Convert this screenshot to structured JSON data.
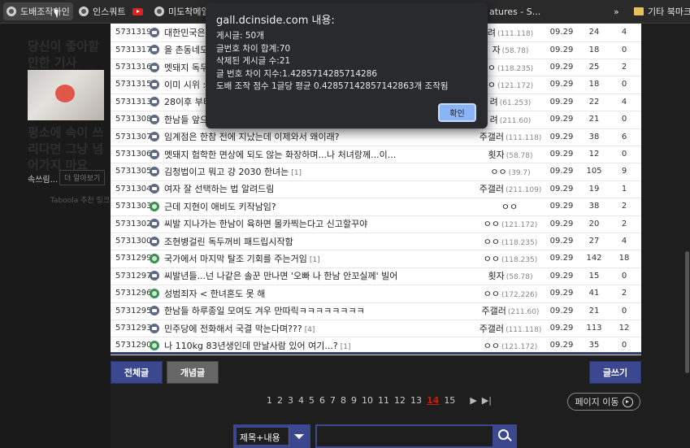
{
  "bookmarks": {
    "items": [
      {
        "label": "도배조작하인",
        "icon": "globe-icon"
      },
      {
        "label": "인스쿼트",
        "icon": "globe-icon"
      },
      {
        "label": "",
        "icon": "youtube-icon"
      },
      {
        "label": "미도착메일",
        "icon": "globe-icon"
      },
      {
        "label": "atures - S...",
        "icon": ""
      }
    ],
    "overflow": "»",
    "other_label": "기타 북마크"
  },
  "ad": {
    "title": "당신이 좋아할 만한 기사",
    "text": "평소에 속이 쓰리다면 그냥 넘어가지 마요",
    "source": "속쓰림...",
    "more": "더 알아보기",
    "provider": "Taboola 추천 링크"
  },
  "posts": [
    {
      "num": "5731319",
      "type": "chat",
      "subject": "대한민국은",
      "comments": "",
      "writer": "려",
      "ip": "(111.118)",
      "date": "09.29",
      "views": "24",
      "recs": "4"
    },
    {
      "num": "5731317",
      "type": "chat",
      "subject": "을 촌동네도",
      "comments": "",
      "writer": "자",
      "ip": "(58.78)",
      "date": "09.29",
      "views": "18",
      "recs": "0"
    },
    {
      "num": "5731316",
      "type": "chat",
      "subject": "멧돼지 독두",
      "comments": "",
      "writer": "ㅇ",
      "ip": "(118.235)",
      "date": "09.29",
      "views": "25",
      "recs": "2"
    },
    {
      "num": "5731315",
      "type": "chat",
      "subject": "이미 시위 :",
      "comments": "",
      "writer": "ㅇ",
      "ip": "(121.172)",
      "date": "09.29",
      "views": "18",
      "recs": "0"
    },
    {
      "num": "5731313",
      "type": "chat",
      "subject": "28이후 부터",
      "comments": "",
      "writer": "려",
      "ip": "(61.253)",
      "date": "09.29",
      "views": "22",
      "recs": "4"
    },
    {
      "num": "5731308",
      "type": "chat",
      "subject": "한남들 앞으",
      "comments": "",
      "writer": "려",
      "ip": "(211.60)",
      "date": "09.29",
      "views": "21",
      "recs": "0"
    },
    {
      "num": "5731307",
      "type": "chat",
      "subject": "임계점은 한참 전에 지났는데 이제와서 왜이래?",
      "comments": "",
      "writer": "주갤러",
      "ip": "(111.118)",
      "date": "09.29",
      "views": "38",
      "recs": "6"
    },
    {
      "num": "5731306",
      "type": "chat",
      "subject": "멧돼지 험학한 면상에 되도 않는 화장하며...나 처녀랑께...이...",
      "comments": "",
      "writer": "횟자",
      "ip": "(58.78)",
      "date": "09.29",
      "views": "12",
      "recs": "0"
    },
    {
      "num": "5731305",
      "type": "chat",
      "subject": "김청법이고 뭐고 걍 2030 한녀는",
      "comments": "[1]",
      "writer": "ㅇㅇ",
      "ip": "(39.7)",
      "date": "09.29",
      "views": "105",
      "recs": "9"
    },
    {
      "num": "5731304",
      "type": "chat",
      "subject": "여자 잘 선택하는 법 알려드림",
      "comments": "",
      "writer": "주갤러",
      "ip": "(211.109)",
      "date": "09.29",
      "views": "19",
      "recs": "1"
    },
    {
      "num": "5731303",
      "type": "green",
      "subject": "근데 지현이 애비도 키작남임?",
      "comments": "",
      "writer": "ㅇㅇ",
      "ip": "",
      "date": "09.29",
      "views": "38",
      "recs": "2"
    },
    {
      "num": "5731302",
      "type": "chat",
      "subject": "씨발 지나가는 한남이 육하면 몰카찍는다고 신고할꾸야",
      "comments": "",
      "writer": "ㅇㅇ",
      "ip": "(121.172)",
      "date": "09.29",
      "views": "20",
      "recs": "2"
    },
    {
      "num": "5731300",
      "type": "chat",
      "subject": "조현병걸린 독두꺼비 패드립시작함",
      "comments": "",
      "writer": "ㅇㅇ",
      "ip": "(118.235)",
      "date": "09.29",
      "views": "27",
      "recs": "4"
    },
    {
      "num": "5731299",
      "type": "green",
      "subject": "국가에서 마지막 탈조 기회를 주는거임",
      "comments": "[1]",
      "writer": "ㅇㅇ",
      "ip": "(118.235)",
      "date": "09.29",
      "views": "142",
      "recs": "18"
    },
    {
      "num": "5731297",
      "type": "chat",
      "subject": "씨발년들...넌 나같은 솔꾼 만나면 '오빠 나 한남 안꼬실께' 빌어",
      "comments": "",
      "writer": "횟자",
      "ip": "(58.78)",
      "date": "09.29",
      "views": "15",
      "recs": "0"
    },
    {
      "num": "5731296",
      "type": "green",
      "subject": "성범죄자 < 한녀혼도 못 해",
      "comments": "",
      "writer": "ㅇㅇ",
      "ip": "(172.226)",
      "date": "09.29",
      "views": "41",
      "recs": "2"
    },
    {
      "num": "5731295",
      "type": "chat",
      "subject": "한남들 하루종일 모여도 겨우 만따릭ㅋㅋㅋㅋㅋㅋㅋㅋ",
      "comments": "",
      "writer": "주갤러",
      "ip": "(211.60)",
      "date": "09.29",
      "views": "21",
      "recs": "0"
    },
    {
      "num": "5731293",
      "type": "chat",
      "subject": "민주당에 전화해서 국결 막는다며???",
      "comments": "[4]",
      "writer": "주갤러",
      "ip": "(111.118)",
      "date": "09.29",
      "views": "113",
      "recs": "12"
    },
    {
      "num": "5731290",
      "type": "green",
      "subject": "나 110kg 83년생인데 만날사람 있어 여기...?",
      "comments": "[1]",
      "writer": "ㅇㅇ",
      "ip": "(121.172)",
      "date": "09.29",
      "views": "35",
      "recs": "0"
    }
  ],
  "buttons": {
    "all_posts": "전체글",
    "concept": "개념글",
    "write": "글쓰기"
  },
  "pagination": {
    "pages": [
      "1",
      "2",
      "3",
      "4",
      "5",
      "6",
      "7",
      "8",
      "9",
      "10",
      "11",
      "12",
      "13",
      "14",
      "15"
    ],
    "current": "14",
    "next": "▶",
    "last": "▶|",
    "jump_label": "페이지 이동"
  },
  "search": {
    "type_label": "제목+내용",
    "query": ""
  },
  "dialog": {
    "title": "gall.dcinside.com 내용:",
    "lines": [
      "게시글: 50개",
      "글번호 차이 합계:70",
      "삭제된 게시글 수:21",
      "글 번호 차이 지수:1.4285714285714286",
      "도배 조작 점수 1글당 평균 0.42857142857142863개 조작됨"
    ],
    "ok_label": "확인"
  },
  "colors": {
    "navy": "#3b4890",
    "current_page": "#d31900",
    "dialog_bg": "#292a2d",
    "dialog_button": "#8ab4f8"
  }
}
